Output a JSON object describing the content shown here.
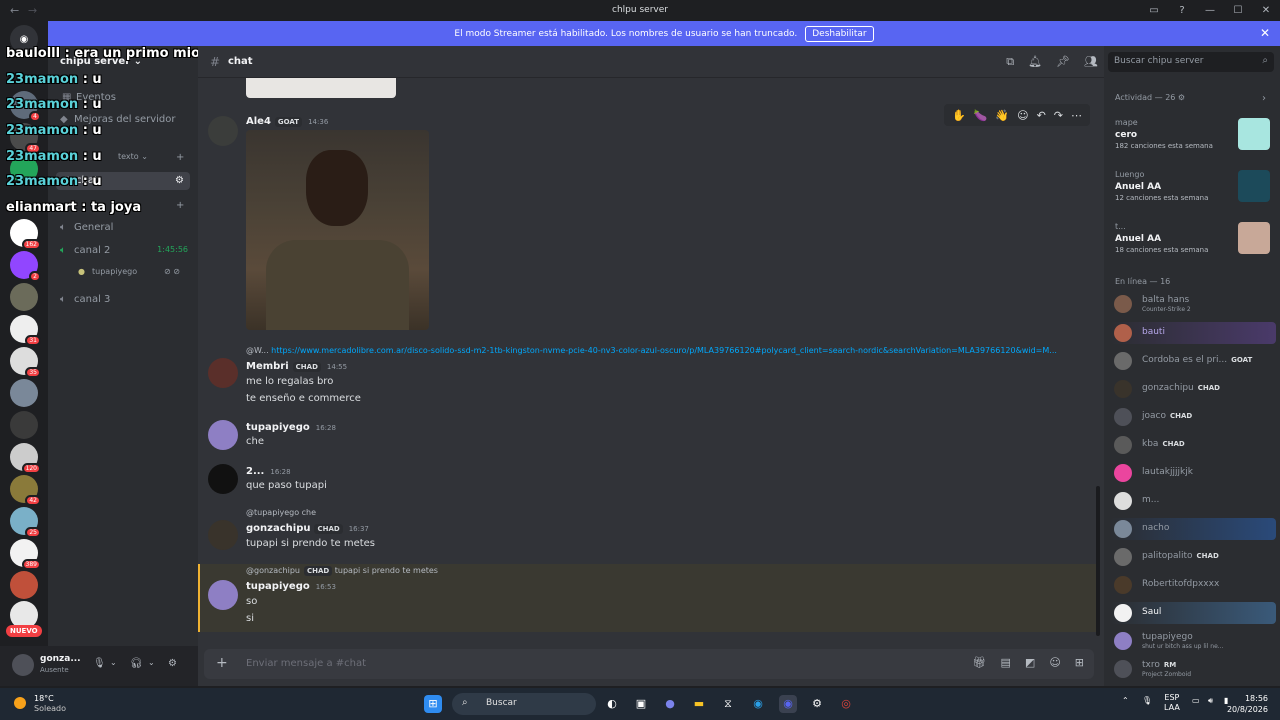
{
  "window": {
    "title": "chlpu server",
    "controls": [
      "▭",
      "?",
      "—",
      "☐",
      "✕"
    ]
  },
  "banner": {
    "text": "El modo Streamer está habilitado. Los nombres de usuario se han truncado.",
    "button": "Deshabilitar"
  },
  "servers": {
    "badges": [
      "",
      "4",
      "47",
      "",
      "",
      "162",
      "2",
      "",
      "31",
      "35",
      "",
      "",
      "120",
      "42",
      "25",
      "389",
      ""
    ],
    "nuevo": "NUEVO"
  },
  "overlay_chat": [
    {
      "name": "baulolll",
      "text": ": era un primo mio..."
    },
    {
      "name": "23mamon",
      "text": ": u"
    },
    {
      "name": "23mamon",
      "text": ": u"
    },
    {
      "name": "23mamon",
      "text": ": u"
    },
    {
      "name": "23mamon",
      "text": ": u"
    },
    {
      "name": "23mamon",
      "text": ": u"
    },
    {
      "name": "elianmart",
      "text": ": ta joya"
    }
  ],
  "channels": {
    "server_name": "chipu server",
    "items": [
      {
        "label": "Eventos"
      },
      {
        "label": "Mejoras del servidor"
      },
      {
        "label": "texto"
      },
      {
        "label": "chat"
      },
      {
        "label": "General"
      },
      {
        "label": "canal 2",
        "time": "1:45:56"
      },
      {
        "label": "tupapiyego"
      },
      {
        "label": "canal 3"
      }
    ]
  },
  "user_panel": {
    "name": "gonza...",
    "status": "Ausente"
  },
  "channel_header": {
    "name": "chat"
  },
  "messages": {
    "m1": {
      "author": "Ale4",
      "tag": "GOAT",
      "time": "14:36"
    },
    "m2": {
      "reply": "@W...",
      "link": "https://www.mercadolibre.com.ar/disco-solido-ssd-m2-1tb-kingston-nvme-pcie-40-nv3-color-azul-oscuro/p/MLA39766120#polycard_client=search-nordic&searchVariation=MLA39766120&wid=M...",
      "author": "Membri",
      "tag": "CHAD",
      "time": "14:55",
      "lines": [
        "me lo regalas bro",
        "te enseño e commerce"
      ]
    },
    "m3": {
      "author": "tupapiyego",
      "time": "16:28",
      "lines": [
        "che"
      ]
    },
    "m4": {
      "author": "2...",
      "time": "16:28",
      "lines": [
        "que paso tupapi"
      ]
    },
    "m5": {
      "reply": "@tupapiyego che",
      "author": "gonzachipu",
      "tag": "CHAD",
      "time": "16:37",
      "lines": [
        "tupapi si prendo te metes"
      ]
    },
    "m6": {
      "reply_user": "@gonzachipu",
      "reply_tag": "CHAD",
      "reply_text": "tupapi si prendo te metes",
      "author": "tupapiyego",
      "time": "16:53",
      "lines": [
        "so",
        "si"
      ]
    }
  },
  "composer": {
    "placeholder": "Enviar mensaje a #chat"
  },
  "sidebar": {
    "search_placeholder": "Buscar chipu server",
    "activity_header": "Actividad — 26",
    "activities": [
      {
        "user": "mape",
        "title": "cero",
        "sub": "182 canciones esta semana"
      },
      {
        "user": "Luengo",
        "title": "Anuel AA",
        "sub": "12 canciones esta semana"
      },
      {
        "user": "t...",
        "title": "Anuel AA",
        "sub": "18 canciones esta semana"
      }
    ],
    "online_header": "En línea — 16",
    "members": [
      {
        "name": "balta hans",
        "tag": "",
        "sub": "Counter-Strike 2"
      },
      {
        "name": "bauti",
        "tag": "",
        "sub": ""
      },
      {
        "name": "Cordoba es el pri...",
        "tag": "GOAT",
        "sub": ""
      },
      {
        "name": "gonzachipu",
        "tag": "CHAD",
        "sub": ""
      },
      {
        "name": "joaco",
        "tag": "CHAD",
        "sub": ""
      },
      {
        "name": "kba",
        "tag": "CHAD",
        "sub": ""
      },
      {
        "name": "lautakjjjjkjk",
        "tag": "",
        "sub": ""
      },
      {
        "name": "m...",
        "tag": "",
        "sub": ""
      },
      {
        "name": "nacho",
        "tag": "",
        "sub": ""
      },
      {
        "name": "palitopalito",
        "tag": "CHAD",
        "sub": ""
      },
      {
        "name": "Robertitofdpxxxx",
        "tag": "",
        "sub": ""
      },
      {
        "name": "Saul",
        "tag": "",
        "sub": ""
      },
      {
        "name": "tupapiyego",
        "tag": "",
        "sub": "shut ur bitch ass up lil ne..."
      },
      {
        "name": "txro",
        "tag": "RM",
        "sub": "Project Zomboid"
      }
    ]
  },
  "taskbar": {
    "temp": "18°C",
    "condition": "Soleado",
    "search": "Buscar",
    "lang1": "ESP",
    "lang2": "LAA",
    "time": "18:56",
    "date": "20/8/2026"
  }
}
